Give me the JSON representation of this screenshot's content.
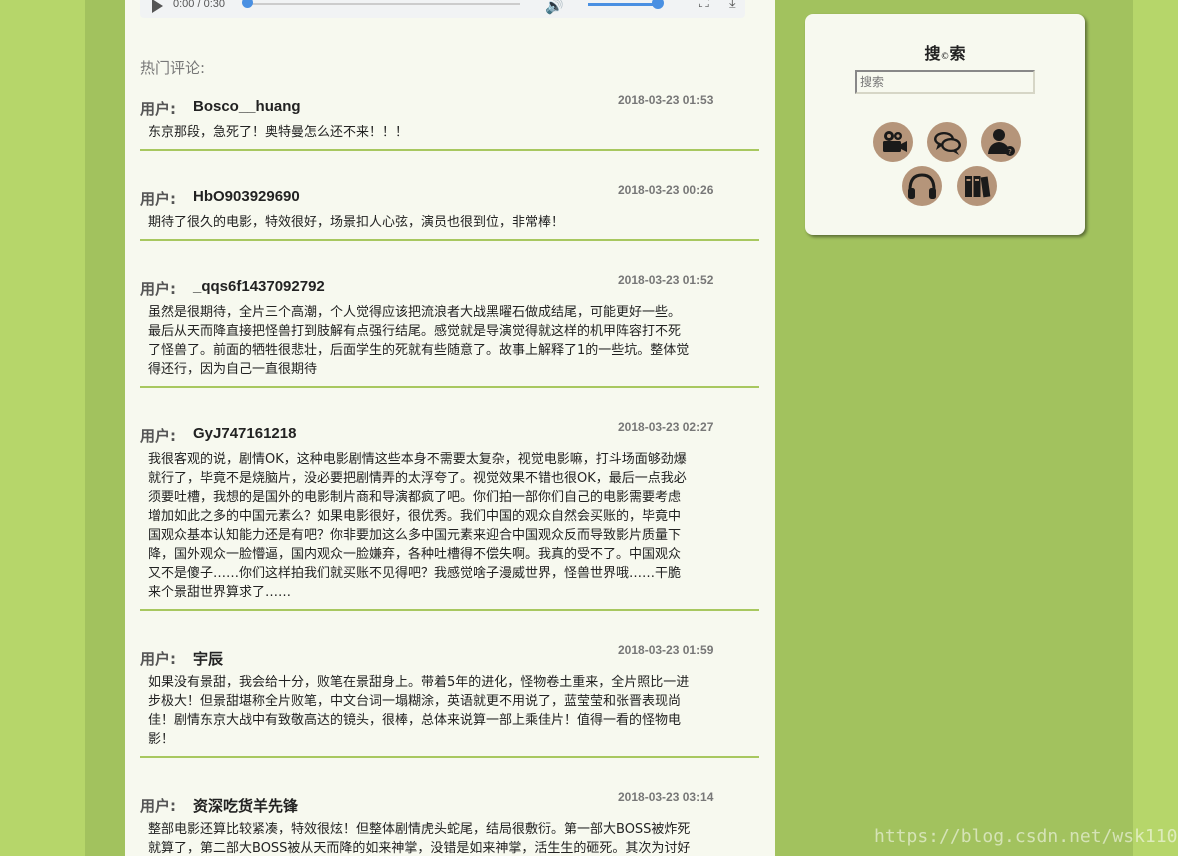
{
  "player": {
    "time": "0:00 / 0:30"
  },
  "section_title": "热门评论:",
  "user_label": "用户:",
  "comments": [
    {
      "user": "Bosco__huang",
      "time": "2018-03-23 01:53",
      "lines": [
        "东京那段，急死了！奥特曼怎么还不来！！！"
      ]
    },
    {
      "user": "HbO903929690",
      "time": "2018-03-23 00:26",
      "lines": [
        "期待了很久的电影，特效很好，场景扣人心弦，演员也很到位，非常棒！"
      ]
    },
    {
      "user": "_qqs6f1437092792",
      "time": "2018-03-23 01:52",
      "lines": [
        "虽然是很期待，全片三个高潮，个人觉得应该把流浪者大战黑曜石做成结尾，可能更好一些。",
        "最后从天而降直接把怪兽打到肢解有点强行结尾。感觉就是导演觉得就这样的机甲阵容打不死",
        "了怪兽了。前面的牺牲很悲壮，后面学生的死就有些随意了。故事上解释了1的一些坑。整体觉",
        "得还行，因为自己一直很期待"
      ]
    },
    {
      "user": "GyJ747161218",
      "time": "2018-03-23 02:27",
      "lines": [
        "我很客观的说，剧情OK，这种电影剧情这些本身不需要太复杂，视觉电影嘛，打斗场面够劲爆",
        "就行了，毕竟不是烧脑片，没必要把剧情弄的太浮夸了。视觉效果不错也很OK，最后一点我必",
        "须要吐槽，我想的是国外的电影制片商和导演都疯了吧。你们拍一部你们自己的电影需要考虑",
        "增加如此之多的中国元素么？如果电影很好，很优秀。我们中国的观众自然会买账的，毕竟中",
        "国观众基本认知能力还是有吧？你非要加这么多中国元素来迎合中国观众反而导致影片质量下",
        "降，国外观众一脸懵逼，国内观众一脸嫌弃，各种吐槽得不偿失啊。我真的受不了。中国观众",
        "又不是傻子……你们这样拍我们就买账不见得吧？我感觉啥子漫威世界，怪兽世界哦……干脆",
        "来个景甜世界算求了……"
      ]
    },
    {
      "user": "宇辰",
      "time": "2018-03-23 01:59",
      "lines": [
        "如果没有景甜，我会给十分，败笔在景甜身上。带着5年的进化，怪物卷土重来，全片照比一进",
        "步极大！但景甜堪称全片败笔，中文台词一塌糊涂，英语就更不用说了，蓝莹莹和张晋表现尚",
        "佳！剧情东京大战中有致敬高达的镜头，很棒，总体来说算一部上乘佳片！值得一看的怪物电",
        "影！"
      ]
    },
    {
      "user": "资深吃货羊先锋",
      "time": "2018-03-23 03:14",
      "lines": [
        "整部电影还算比较紧凑，特效很炫！但整体剧情虎头蛇尾，结局很敷衍。第一部大BOSS被炸死",
        "就算了，第二部大BOSS被从天而降的如来神掌，没错是如来神掌，活生生的砸死。其次为讨好"
      ]
    }
  ],
  "sidebar": {
    "title_a": "搜",
    "title_dot": "©",
    "title_b": "索",
    "search_placeholder": "搜索",
    "icons": [
      "movie-camera-icon",
      "chat-bubbles-icon",
      "user-help-icon",
      "headphones-icon",
      "books-icon"
    ]
  },
  "colors": {
    "page_bg": "#b6d66a",
    "band_bg": "#a2c25e",
    "panel_bg": "#f7f9ef",
    "accent_line": "#a8c85f",
    "icon_circle": "#b5957a"
  },
  "watermark": "https://blog.csdn.net/wsk1103"
}
